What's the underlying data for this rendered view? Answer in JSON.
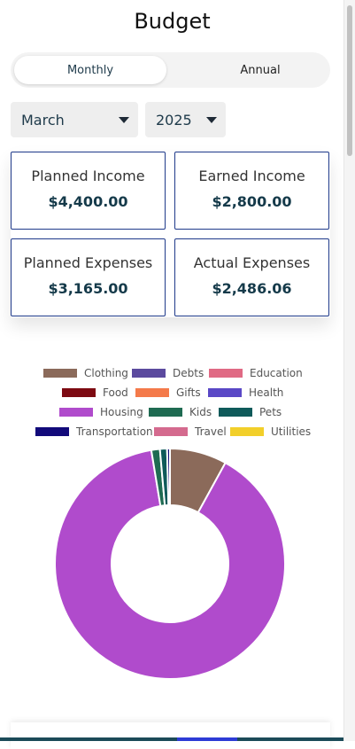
{
  "header": {
    "title": "Budget"
  },
  "view_toggle": {
    "monthly": "Monthly",
    "annual": "Annual",
    "selected": "Monthly"
  },
  "filters": {
    "month": "March",
    "year": "2025"
  },
  "summary": {
    "planned_income": {
      "label": "Planned Income",
      "amount": "$4,400.00"
    },
    "earned_income": {
      "label": "Earned Income",
      "amount": "$2,800.00"
    },
    "planned_expenses": {
      "label": "Planned Expenses",
      "amount": "$3,165.00"
    },
    "actual_expenses": {
      "label": "Actual Expenses",
      "amount": "$2,486.06"
    }
  },
  "legend": [
    {
      "label": "Clothing",
      "color": "#8b6a5a"
    },
    {
      "label": "Debts",
      "color": "#5b4a9e"
    },
    {
      "label": "Education",
      "color": "#e06a84"
    },
    {
      "label": "Food",
      "color": "#7d0a12"
    },
    {
      "label": "Gifts",
      "color": "#f47a4a"
    },
    {
      "label": "Health",
      "color": "#5a48c6"
    },
    {
      "label": "Housing",
      "color": "#b04bcc"
    },
    {
      "label": "Kids",
      "color": "#1f6b52"
    },
    {
      "label": "Pets",
      "color": "#0f5a5a"
    },
    {
      "label": "Transportation",
      "color": "#120a7a"
    },
    {
      "label": "Travel",
      "color": "#d46a8e"
    },
    {
      "label": "Utilities",
      "color": "#f2cf2a"
    }
  ],
  "chart_data": {
    "type": "pie",
    "donut": true,
    "slices": [
      {
        "name": "Clothing",
        "value": 8.0,
        "color": "#8b6a5a"
      },
      {
        "name": "Housing",
        "value": 89.4,
        "color": "#b04bcc"
      },
      {
        "name": "Kids",
        "value": 1.2,
        "color": "#1f6b52"
      },
      {
        "name": "Pets",
        "value": 1.0,
        "color": "#0f5a5a"
      },
      {
        "name": "Transportation",
        "value": 0.4,
        "color": "#120a7a"
      }
    ]
  }
}
